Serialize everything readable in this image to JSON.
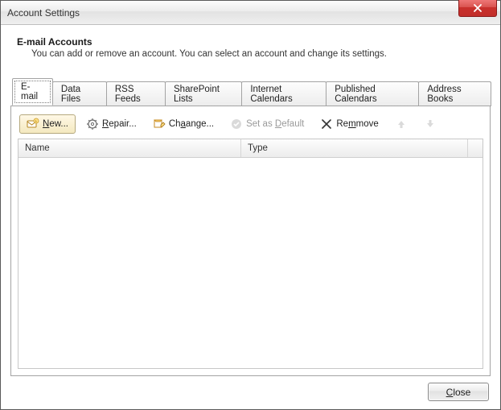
{
  "window": {
    "title": "Account Settings"
  },
  "header": {
    "title": "E-mail Accounts",
    "description": "You can add or remove an account. You can select an account and change its settings."
  },
  "tabs": [
    {
      "label": "E-mail",
      "active": true
    },
    {
      "label": "Data Files"
    },
    {
      "label": "RSS Feeds"
    },
    {
      "label": "SharePoint Lists"
    },
    {
      "label": "Internet Calendars"
    },
    {
      "label": "Published Calendars"
    },
    {
      "label": "Address Books"
    }
  ],
  "toolbar": {
    "new_prefix": "N",
    "new_rest_label": "ew...",
    "repair_prefix": "R",
    "repair_rest_label": "epair...",
    "change_prefix": "Ch",
    "change_rest_label": "ange...",
    "default_label": "Set as Default",
    "remove_prefix": "Re",
    "remove_rest_label": "move"
  },
  "list": {
    "columns": {
      "name": "Name",
      "type": "Type"
    },
    "rows": []
  },
  "footer": {
    "close_prefix": "C",
    "close_rest_label": "lose"
  }
}
